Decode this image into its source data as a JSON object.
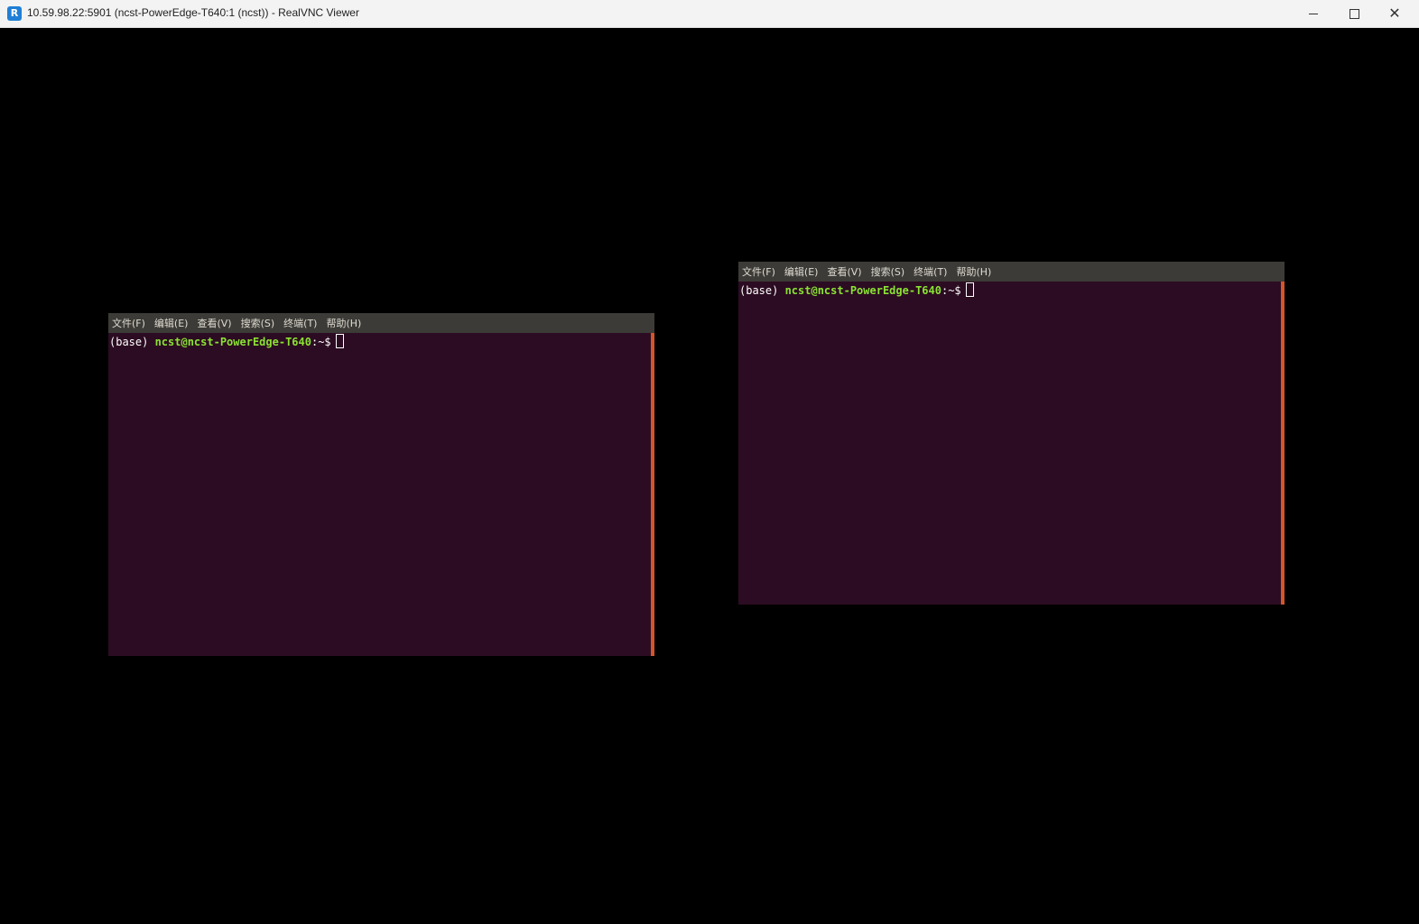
{
  "window": {
    "title": "10.59.98.22:5901 (ncst-PowerEdge-T640:1 (ncst)) - RealVNC Viewer",
    "icon": "realvnc-icon",
    "controls": {
      "minimize_icon": "minimize-icon",
      "maximize_icon": "maximize-icon",
      "close_icon": "close-icon",
      "close_glyph": "✕"
    }
  },
  "terminals": [
    {
      "menu": [
        "文件(F)",
        "编辑(E)",
        "查看(V)",
        "搜索(S)",
        "终端(T)",
        "帮助(H)"
      ],
      "prompt": {
        "env": "(base) ",
        "user_host": "ncst@ncst-PowerEdge-T640",
        "path_symbol": ":~$"
      }
    },
    {
      "menu": [
        "文件(F)",
        "编辑(E)",
        "查看(V)",
        "搜索(S)",
        "终端(T)",
        "帮助(H)"
      ],
      "prompt": {
        "env": "(base) ",
        "user_host": "ncst@ncst-PowerEdge-T640",
        "path_symbol": ":~$"
      }
    }
  ],
  "colors": {
    "terminal_bg": "#2c0c22",
    "menubar_bg": "#3c3b37",
    "prompt_user": "#8ae234",
    "scroll_edge": "#d3562a"
  }
}
